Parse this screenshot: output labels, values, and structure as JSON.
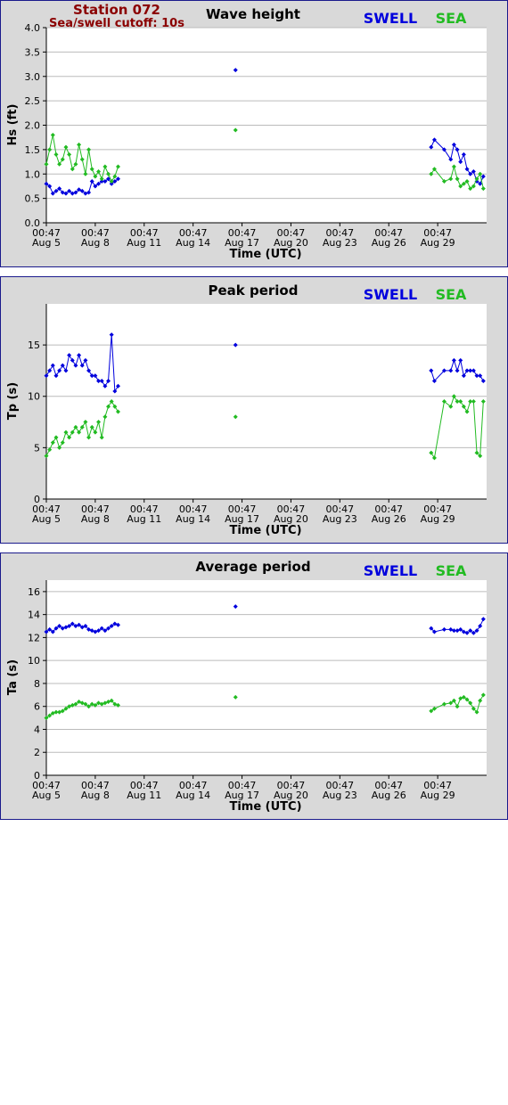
{
  "header": {
    "station": "Station 072",
    "cutoff": "Sea/swell cutoff: 10s"
  },
  "legend": {
    "swell": "SWELL",
    "sea": "SEA",
    "swell_color": "#0000dd",
    "sea_color": "#22bb22"
  },
  "x_axis": {
    "label": "Time (UTC)",
    "tick_time": "00:47",
    "tick_dates": [
      "Aug 5",
      "Aug 8",
      "Aug 11",
      "Aug 14",
      "Aug 17",
      "Aug 20",
      "Aug 23",
      "Aug 26",
      "Aug 29"
    ],
    "tick_days": [
      0,
      3,
      6,
      9,
      12,
      15,
      18,
      21,
      24
    ],
    "range_days": [
      0,
      27
    ]
  },
  "chart_data": [
    {
      "type": "scatter",
      "title": "Wave height",
      "ylabel": "Hs (ft)",
      "ylim": [
        0,
        4
      ],
      "yticks": [
        "0.0",
        "0.5",
        "1.0",
        "1.5",
        "2.0",
        "2.5",
        "3.0",
        "3.5",
        "4.0"
      ],
      "grid": true,
      "series": [
        {
          "name": "SWELL",
          "x": [
            0.0,
            0.2,
            0.4,
            0.6,
            0.8,
            1.0,
            1.2,
            1.4,
            1.6,
            1.8,
            2.0,
            2.2,
            2.4,
            2.6,
            2.8,
            3.0,
            3.2,
            3.4,
            3.6,
            3.8,
            4.0,
            4.2,
            4.4,
            11.6,
            23.6,
            23.8,
            24.4,
            24.8,
            25.0,
            25.2,
            25.4,
            25.6,
            25.8,
            26.0,
            26.2,
            26.4,
            26.6,
            26.8
          ],
          "values": [
            0.8,
            0.75,
            0.6,
            0.65,
            0.7,
            0.62,
            0.6,
            0.65,
            0.6,
            0.62,
            0.68,
            0.65,
            0.6,
            0.62,
            0.85,
            0.75,
            0.8,
            0.85,
            0.85,
            0.9,
            0.8,
            0.85,
            0.9,
            3.13,
            1.55,
            1.7,
            1.5,
            1.3,
            1.6,
            1.5,
            1.25,
            1.4,
            1.1,
            1.0,
            1.05,
            0.85,
            0.8,
            0.95
          ]
        },
        {
          "name": "SEA",
          "x": [
            0.0,
            0.2,
            0.4,
            0.6,
            0.8,
            1.0,
            1.2,
            1.4,
            1.6,
            1.8,
            2.0,
            2.2,
            2.4,
            2.6,
            2.8,
            3.0,
            3.2,
            3.4,
            3.6,
            3.8,
            4.0,
            4.2,
            4.4,
            11.6,
            23.6,
            23.8,
            24.4,
            24.8,
            25.0,
            25.2,
            25.4,
            25.6,
            25.8,
            26.0,
            26.2,
            26.4,
            26.6,
            26.8
          ],
          "values": [
            1.2,
            1.5,
            1.8,
            1.4,
            1.2,
            1.3,
            1.55,
            1.4,
            1.1,
            1.2,
            1.6,
            1.3,
            1.0,
            1.5,
            1.1,
            0.95,
            1.05,
            0.9,
            1.15,
            1.0,
            0.85,
            0.95,
            1.15,
            1.9,
            1.0,
            1.1,
            0.85,
            0.9,
            1.15,
            0.9,
            0.75,
            0.8,
            0.85,
            0.7,
            0.75,
            0.9,
            1.0,
            0.7
          ]
        }
      ]
    },
    {
      "type": "scatter",
      "title": "Peak period",
      "ylabel": "Tp (s)",
      "ylim": [
        0,
        19
      ],
      "yticks": [
        "0",
        "5",
        "10",
        "15"
      ],
      "ytick_values": [
        0,
        5,
        10,
        15
      ],
      "grid": true,
      "series": [
        {
          "name": "SWELL",
          "x": [
            0.0,
            0.2,
            0.4,
            0.6,
            0.8,
            1.0,
            1.2,
            1.4,
            1.6,
            1.8,
            2.0,
            2.2,
            2.4,
            2.6,
            2.8,
            3.0,
            3.2,
            3.4,
            3.6,
            3.8,
            4.0,
            4.2,
            4.4,
            11.6,
            23.6,
            23.8,
            24.4,
            24.8,
            25.0,
            25.2,
            25.4,
            25.6,
            25.8,
            26.0,
            26.2,
            26.4,
            26.6,
            26.8
          ],
          "values": [
            12.0,
            12.5,
            13.0,
            12.0,
            12.5,
            13.0,
            12.5,
            14.0,
            13.5,
            13.0,
            14.0,
            13.0,
            13.5,
            12.5,
            12.0,
            12.0,
            11.5,
            11.5,
            11.0,
            11.5,
            16.0,
            10.5,
            11.0,
            15.0,
            12.5,
            11.5,
            12.5,
            12.5,
            13.5,
            12.5,
            13.5,
            12.0,
            12.5,
            12.5,
            12.5,
            12.0,
            12.0,
            11.5
          ]
        },
        {
          "name": "SEA",
          "x": [
            0.0,
            0.2,
            0.4,
            0.6,
            0.8,
            1.0,
            1.2,
            1.4,
            1.6,
            1.8,
            2.0,
            2.2,
            2.4,
            2.6,
            2.8,
            3.0,
            3.2,
            3.4,
            3.6,
            3.8,
            4.0,
            4.2,
            4.4,
            11.6,
            23.6,
            23.8,
            24.4,
            24.8,
            25.0,
            25.2,
            25.4,
            25.6,
            25.8,
            26.0,
            26.2,
            26.4,
            26.6,
            26.8
          ],
          "values": [
            4.2,
            4.8,
            5.5,
            6.0,
            5.0,
            5.5,
            6.5,
            6.0,
            6.5,
            7.0,
            6.5,
            7.0,
            7.5,
            6.0,
            7.0,
            6.5,
            7.5,
            6.0,
            8.0,
            9.0,
            9.5,
            9.0,
            8.5,
            8.0,
            4.5,
            4.0,
            9.5,
            9.0,
            10.0,
            9.5,
            9.5,
            9.0,
            8.5,
            9.5,
            9.5,
            4.5,
            4.2,
            9.5
          ]
        }
      ]
    },
    {
      "type": "scatter",
      "title": "Average period",
      "ylabel": "Ta (s)",
      "ylim": [
        0,
        17
      ],
      "yticks": [
        "0",
        "2",
        "4",
        "6",
        "8",
        "10",
        "12",
        "14",
        "16"
      ],
      "ytick_values": [
        0,
        2,
        4,
        6,
        8,
        10,
        12,
        14,
        16
      ],
      "grid": true,
      "series": [
        {
          "name": "SWELL",
          "x": [
            0.0,
            0.2,
            0.4,
            0.6,
            0.8,
            1.0,
            1.2,
            1.4,
            1.6,
            1.8,
            2.0,
            2.2,
            2.4,
            2.6,
            2.8,
            3.0,
            3.2,
            3.4,
            3.6,
            3.8,
            4.0,
            4.2,
            4.4,
            11.6,
            23.6,
            23.8,
            24.4,
            24.8,
            25.0,
            25.2,
            25.4,
            25.6,
            25.8,
            26.0,
            26.2,
            26.4,
            26.6,
            26.8
          ],
          "values": [
            12.5,
            12.7,
            12.5,
            12.8,
            13.0,
            12.8,
            12.9,
            13.0,
            13.2,
            13.0,
            13.1,
            12.9,
            13.0,
            12.7,
            12.6,
            12.5,
            12.6,
            12.8,
            12.6,
            12.8,
            13.0,
            13.2,
            13.1,
            14.7,
            12.8,
            12.5,
            12.7,
            12.7,
            12.6,
            12.6,
            12.7,
            12.5,
            12.4,
            12.6,
            12.4,
            12.6,
            13.0,
            13.6
          ]
        },
        {
          "name": "SEA",
          "x": [
            0.0,
            0.2,
            0.4,
            0.6,
            0.8,
            1.0,
            1.2,
            1.4,
            1.6,
            1.8,
            2.0,
            2.2,
            2.4,
            2.6,
            2.8,
            3.0,
            3.2,
            3.4,
            3.6,
            3.8,
            4.0,
            4.2,
            4.4,
            11.6,
            23.6,
            23.8,
            24.4,
            24.8,
            25.0,
            25.2,
            25.4,
            25.6,
            25.8,
            26.0,
            26.2,
            26.4,
            26.6,
            26.8
          ],
          "values": [
            5.0,
            5.2,
            5.4,
            5.5,
            5.5,
            5.6,
            5.8,
            6.0,
            6.1,
            6.2,
            6.4,
            6.3,
            6.2,
            6.0,
            6.2,
            6.1,
            6.3,
            6.2,
            6.3,
            6.4,
            6.5,
            6.2,
            6.1,
            6.8,
            5.6,
            5.8,
            6.2,
            6.3,
            6.5,
            6.0,
            6.7,
            6.8,
            6.6,
            6.3,
            5.8,
            5.5,
            6.5,
            7.0
          ]
        }
      ]
    }
  ]
}
